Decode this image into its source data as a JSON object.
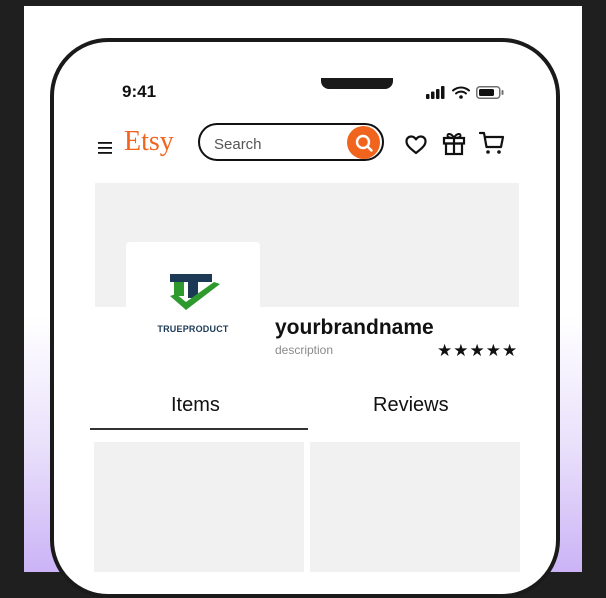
{
  "status_bar": {
    "time": "9:41"
  },
  "header": {
    "logo": "Etsy",
    "search": {
      "placeholder": "Search",
      "value": ""
    },
    "icons": [
      "menu-icon",
      "search-icon",
      "heart-icon",
      "gift-icon",
      "cart-icon"
    ]
  },
  "shop": {
    "logo_text": "TRUEPRODUCT",
    "name": "yourbrandname",
    "description": "description",
    "rating_stars": "★★★★★",
    "rating": 5
  },
  "tabs": [
    {
      "label": "Items",
      "active": true
    },
    {
      "label": "Reviews",
      "active": false
    }
  ],
  "colors": {
    "brand": "#f1641e",
    "logo_green": "#2e9a2e",
    "logo_navy": "#1c3a56",
    "placeholder_gray": "#f1f1f1"
  }
}
